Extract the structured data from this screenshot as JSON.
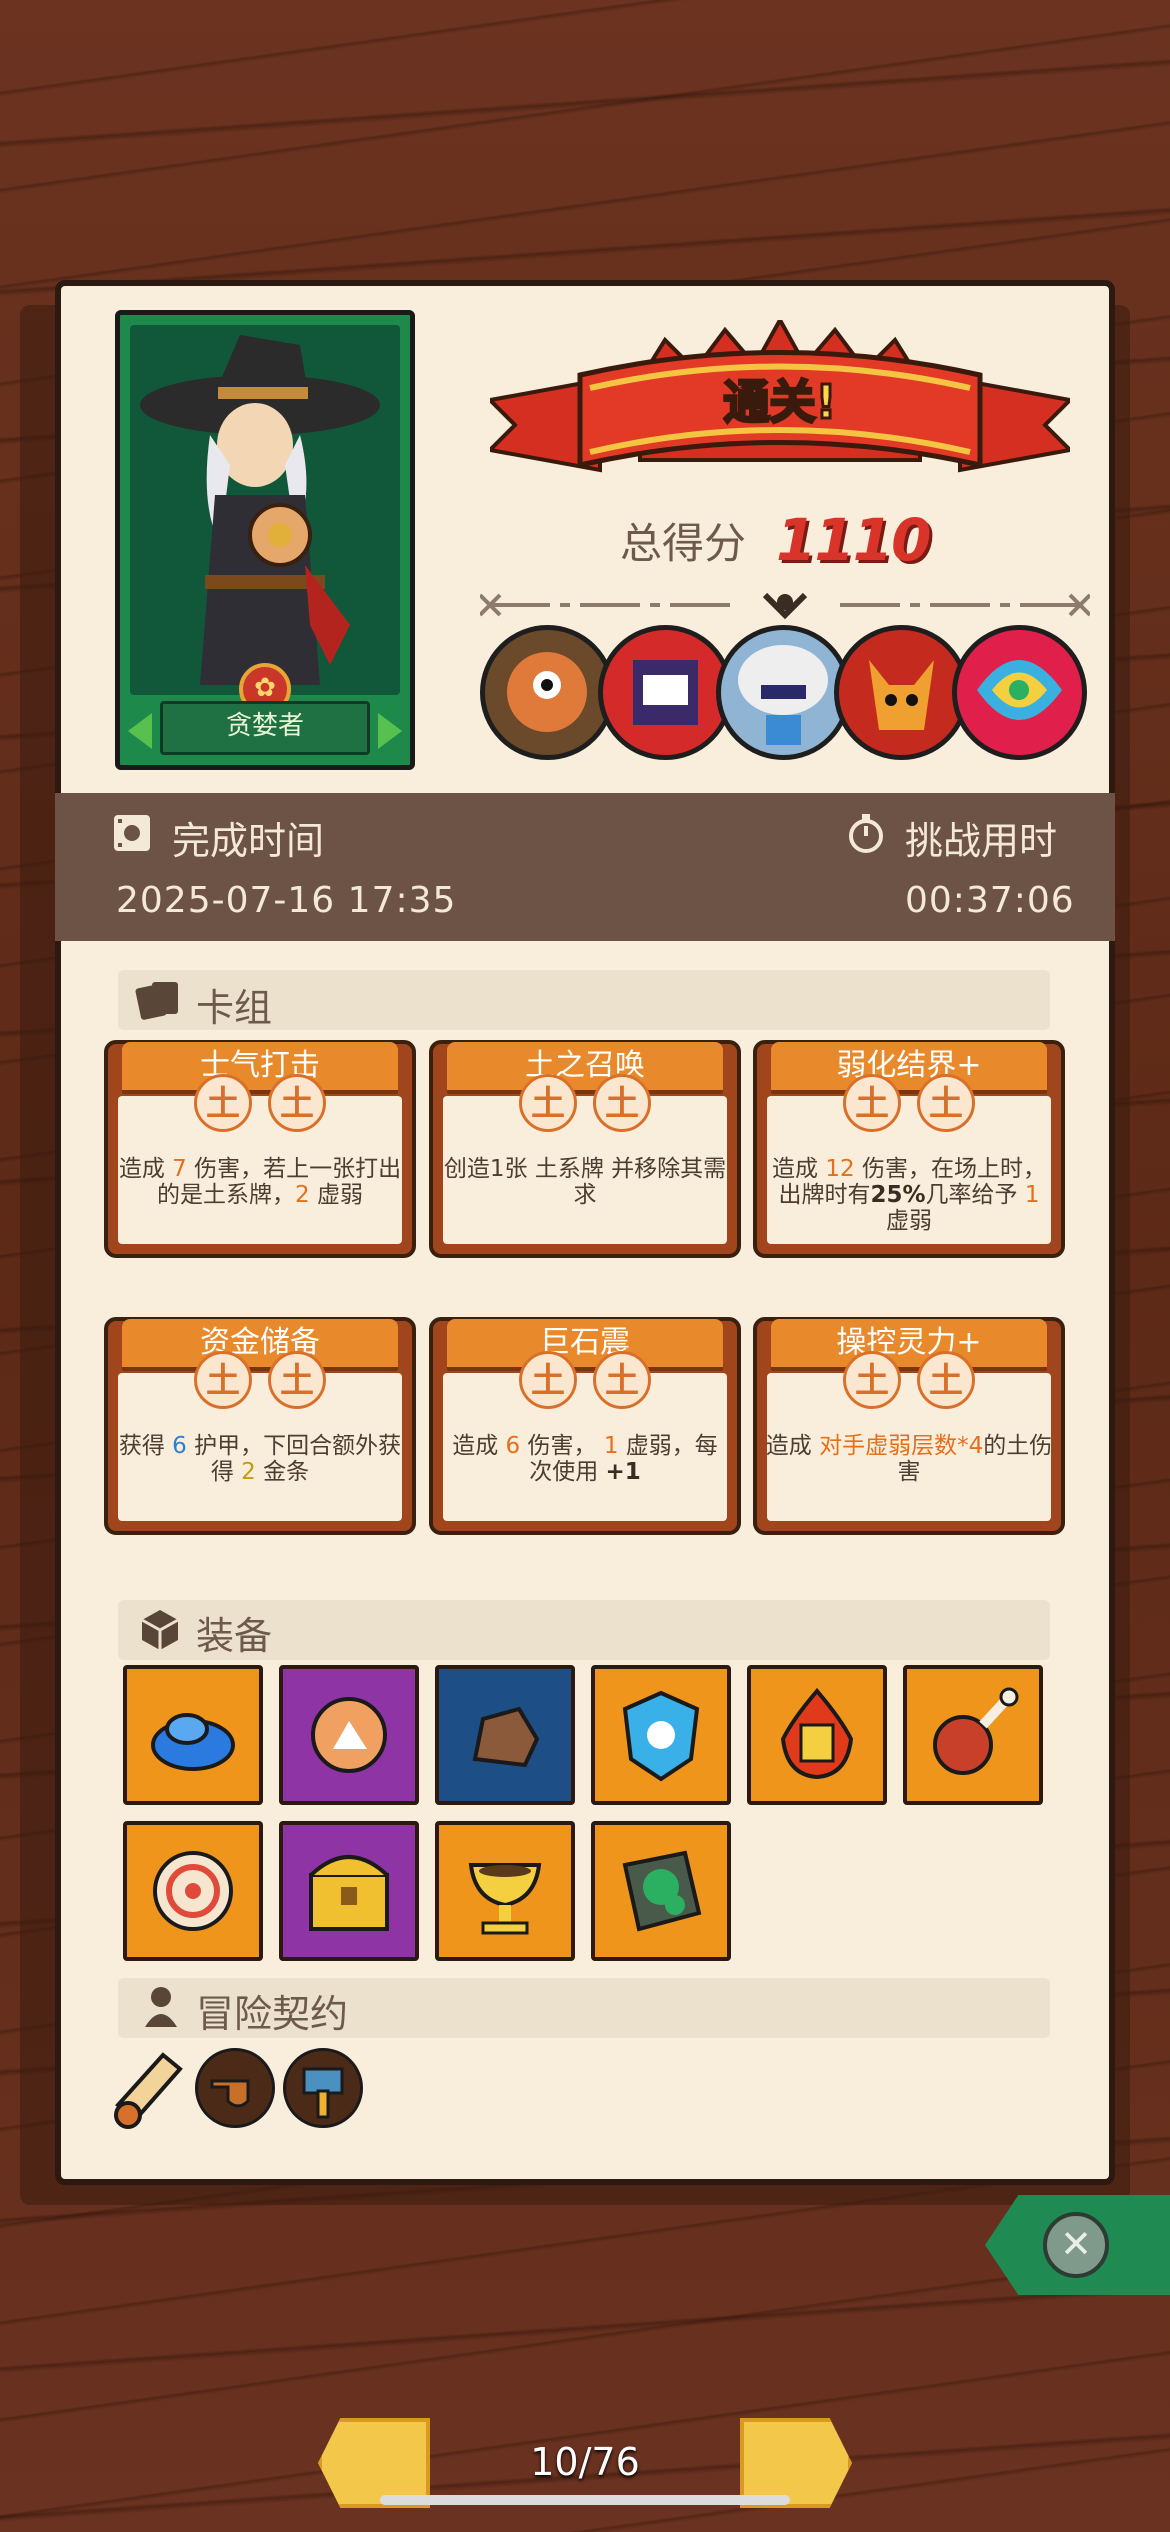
{
  "character": {
    "name": "贪婪者",
    "emblem": "✿"
  },
  "result": {
    "banner_text": "通关!",
    "score_label": "总得分",
    "score_value": "1110"
  },
  "bosses": [
    "boss-1",
    "boss-2",
    "boss-3",
    "boss-4",
    "boss-5"
  ],
  "times": {
    "finish_label": "完成时间",
    "finish_value": "2025-07-16  17:35",
    "challenge_label": "挑战用时",
    "challenge_value": "00:37:06"
  },
  "deck": {
    "title": "卡组",
    "cards": [
      {
        "name": "士气打击",
        "cost": [
          "土",
          "土"
        ],
        "desc_parts": [
          "造成 ",
          "7",
          " 伤害，若上一张打出的是土系牌，",
          "2",
          " 虚弱"
        ]
      },
      {
        "name": "土之召唤",
        "cost": [
          "土",
          "土"
        ],
        "desc_parts": [
          "创造1张 ",
          "",
          "土系牌 并移除其需求"
        ]
      },
      {
        "name": "弱化结界+",
        "cost": [
          "土",
          "土"
        ],
        "desc_parts": [
          "造成 ",
          "12",
          " 伤害，在场上时，出牌时有",
          "25%",
          "几率给予 ",
          "1",
          " 虚弱"
        ]
      },
      {
        "name": "资金储备",
        "cost": [
          "土",
          "土"
        ],
        "desc_parts": [
          "获得 ",
          "6",
          " 护甲，下回合额外获得 ",
          "2",
          " 金条"
        ]
      },
      {
        "name": "巨石震",
        "cost": [
          "土",
          "土"
        ],
        "desc_parts": [
          "造成 ",
          "6",
          " 伤害， ",
          "1",
          " 虚弱，每次使用 ",
          "+1"
        ]
      },
      {
        "name": "操控灵力+",
        "cost": [
          "土",
          "土"
        ],
        "desc_parts": [
          "造成 ",
          "对手虚弱层数*4",
          "的土伤害"
        ]
      }
    ]
  },
  "equipment": {
    "title": "装备",
    "items": [
      {
        "name": "blue-slime",
        "color": "orange"
      },
      {
        "name": "clay-pot",
        "color": "purple"
      },
      {
        "name": "rock",
        "color": "blue"
      },
      {
        "name": "ice-shield",
        "color": "orange"
      },
      {
        "name": "fire-gem",
        "color": "orange"
      },
      {
        "name": "meat",
        "color": "orange"
      },
      {
        "name": "shield-ring",
        "color": "orange"
      },
      {
        "name": "treasure-chest",
        "color": "purple"
      },
      {
        "name": "golden-chalice",
        "color": "orange"
      },
      {
        "name": "moss-stone",
        "color": "orange"
      }
    ]
  },
  "contracts": {
    "title": "冒险契约",
    "items": [
      "scroll",
      "pipe",
      "hammer"
    ]
  },
  "pagination": {
    "current": "10/76"
  },
  "colors": {
    "accent": "#e88a2b",
    "score": "#d9342a",
    "banner": "#d52f21"
  }
}
